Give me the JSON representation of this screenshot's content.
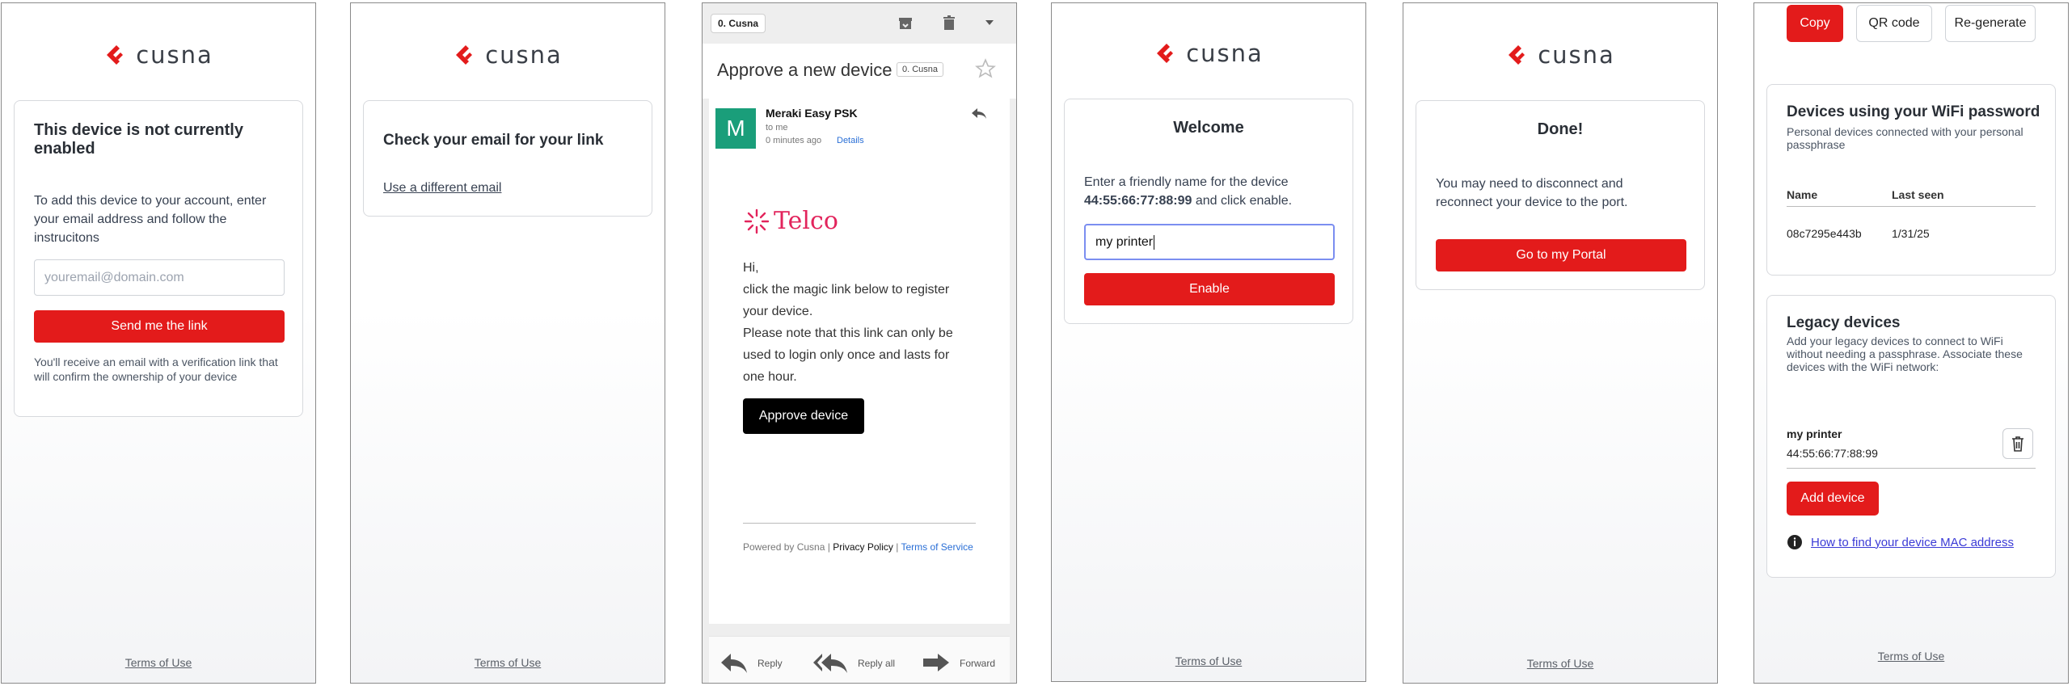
{
  "brand": {
    "name": "cusna",
    "accent": "#e31b1b"
  },
  "terms_label": "Terms of Use",
  "screen1": {
    "title": "This device is not currently enabled",
    "instructions": "To add this device to your account, enter your email address and follow the instrucitons",
    "email_placeholder": "youremail@domain.com",
    "send_button": "Send me the link",
    "note": "You'll receive an email with a verification link that will confirm the ownership of your device"
  },
  "screen2": {
    "title": "Check your email for your link",
    "different_email_link": "Use a different email"
  },
  "email": {
    "folder_tag": "0. Cusna",
    "subject": "Approve a new device",
    "subject_tag": "0. Cusna",
    "avatar_letter": "M",
    "sender": "Meraki Easy PSK",
    "to": "to me",
    "time": "0 minutes ago",
    "details_link": "Details",
    "company": "Telco",
    "greeting": "Hi,",
    "para1": "click the magic link below to register your device.",
    "para2": "Please note that this link can only be used to login only once and lasts for one hour.",
    "approve_button": "Approve device",
    "powered_by": "Powered by Cusna",
    "privacy": "Privacy Policy",
    "terms_service": "Terms of Service",
    "actions": {
      "reply": "Reply",
      "reply_all": "Reply all",
      "forward": "Forward"
    }
  },
  "screen4": {
    "title": "Welcome",
    "line1": "Enter a friendly name for the device",
    "mac": "44:55:66:77:88:99",
    "line2_suffix": " and click enable.",
    "name_value": "my printer",
    "enable_button": "Enable"
  },
  "screen5": {
    "title": "Done!",
    "message": "You may need to disconnect and reconnect your device to the port.",
    "portal_button": "Go to my Portal"
  },
  "screen6": {
    "copy_button": "Copy",
    "qr_button": "QR code",
    "regen_button": "Re-generate",
    "devices_title": "Devices using your WiFi password",
    "devices_subtitle": "Personal devices connected with your personal passphrase",
    "columns": [
      "Name",
      "Last seen"
    ],
    "rows": [
      {
        "name": "08c7295e443b",
        "last_seen": "1/31/25"
      }
    ],
    "legacy_title": "Legacy devices",
    "legacy_desc": "Add your legacy devices to connect to WiFi without needing a passphrase. Associate these devices with the WiFi network:",
    "legacy_device_name": "my printer",
    "legacy_device_mac": "44:55:66:77:88:99",
    "add_button": "Add device",
    "help_link": "How to find your device MAC address"
  }
}
